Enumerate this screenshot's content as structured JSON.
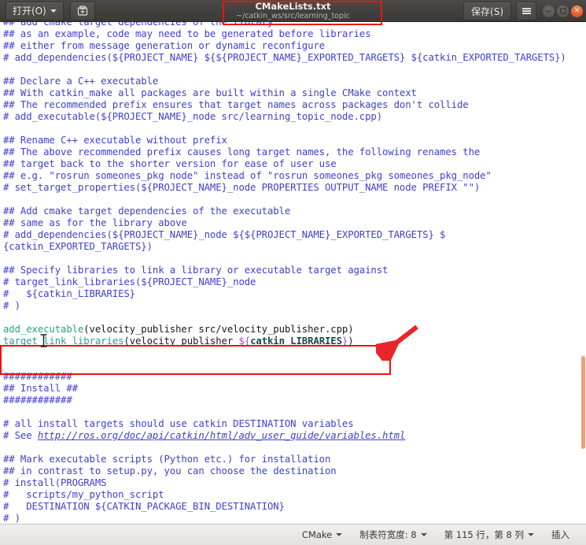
{
  "titlebar": {
    "open_label": "打开(O)",
    "saveas_icon": "save-as-icon",
    "title": "CMakeLists.txt",
    "subtitle": "~/catkin_ws/src/learning_topic",
    "save_label": "保存(S)",
    "menu_icon": "hamburger-menu-icon",
    "minimize_icon": "minimize-icon",
    "maximize_icon": "maximize-icon",
    "close_icon": "close-icon",
    "close_glyph": "✕",
    "annotation_color": "#ee1111"
  },
  "editor": {
    "language": "CMake",
    "text": "## add cmake target dependencies of the library\n## as an example, code may need to be generated before libraries\n## either from message generation or dynamic reconfigure\n# add_dependencies(${PROJECT_NAME} ${${PROJECT_NAME}_EXPORTED_TARGETS} ${catkin_EXPORTED_TARGETS})\n\n## Declare a C++ executable\n## With catkin_make all packages are built within a single CMake context\n## The recommended prefix ensures that target names across packages don't collide\n# add_executable(${PROJECT_NAME}_node src/learning_topic_node.cpp)\n\n## Rename C++ executable without prefix\n## The above recommended prefix causes long target names, the following renames the\n## target back to the shorter version for ease of user use\n## e.g. \"rosrun someones_pkg node\" instead of \"rosrun someones_pkg someones_pkg_node\"\n# set_target_properties(${PROJECT_NAME}_node PROPERTIES OUTPUT_NAME node PREFIX \"\")\n\n## Add cmake target dependencies of the executable\n## same as for the library above\n# add_dependencies(${PROJECT_NAME}_node ${${PROJECT_NAME}_EXPORTED_TARGETS} ${catkin_EXPORTED_TARGETS})\n\n## Specify libraries to link a library or executable target against\n# target_link_libraries(${PROJECT_NAME}_node\n#   ${catkin_LIBRARIES}\n# )\n\nadd_executable(velocity_publisher src/velocity_publisher.cpp)\ntarget_link_libraries(velocity_publisher ${catkin_LIBRARIES})\n\n\n############\n## Install ##\n############\n\n# all install targets should use catkin DESTINATION variables\n# See http://ros.org/doc/api/catkin/html/adv_user_guide/variables.html\n\n## Mark executable scripts (Python etc.) for installation\n## in contrast to setup.py, you can choose the destination\n# install(PROGRAMS\n#   scripts/my_python_script\n#   DESTINATION ${CATKIN_PACKAGE_BIN_DESTINATION}\n# )",
    "highlighted_lines": [
      "add_executable(velocity_publisher src/velocity_publisher.cpp)",
      "target_link_libraries(velocity_publisher ${catkin_LIBRARIES})"
    ],
    "link_url": "http://ros.org/doc/api/catkin/html/adv_user_guide/variables.html",
    "comment_color": "#4040d0",
    "function_color": "#2a9d8f",
    "variable_delim_color": "#9a4fd0",
    "annotation_color": "#ee1111",
    "arrow_color": "#e8262a",
    "scrollbar_color": "#f0a070"
  },
  "statusbar": {
    "language": "CMake",
    "tab_width": "制表符宽度: 8",
    "position": "第 115 行，第 8 列",
    "insert_mode": "插入"
  }
}
